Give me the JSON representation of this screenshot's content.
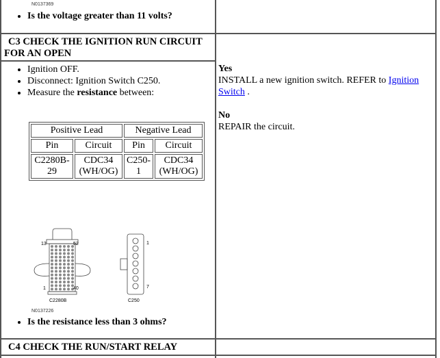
{
  "prev": {
    "figure_id": "N0137369",
    "question": "Is the voltage greater than 11 volts?"
  },
  "c3": {
    "title": "C3 CHECK THE IGNITION RUN CIRCUIT FOR AN OPEN",
    "steps": [
      "Ignition OFF.",
      "Disconnect: Ignition Switch C250."
    ],
    "measure_prefix": "Measure the ",
    "measure_bold": "resistance",
    "measure_suffix": " between:",
    "table": {
      "pos_header": "Positive Lead",
      "neg_header": "Negative Lead",
      "pin": "Pin",
      "circuit": "Circuit",
      "row": [
        "C2280B-29",
        "CDC34 (WH/OG)",
        "C250-1",
        "CDC34 (WH/OG)"
      ]
    },
    "diagram": {
      "left_label": "C2280B",
      "right_label": "C250",
      "pins_left": [
        "13",
        "52",
        "1",
        "40"
      ],
      "pins_right": [
        "1",
        "7"
      ],
      "figure_id": "N0137226"
    },
    "question": "Is the resistance less than 3 ohms?",
    "yes_label": "Yes",
    "yes_text": "INSTALL a new ignition switch. REFER to ",
    "yes_link": "Ignition Switch",
    "yes_end": " .",
    "no_label": "No",
    "no_text": "REPAIR the circuit."
  },
  "c4": {
    "title": "C4 CHECK THE RUN/START RELAY"
  }
}
